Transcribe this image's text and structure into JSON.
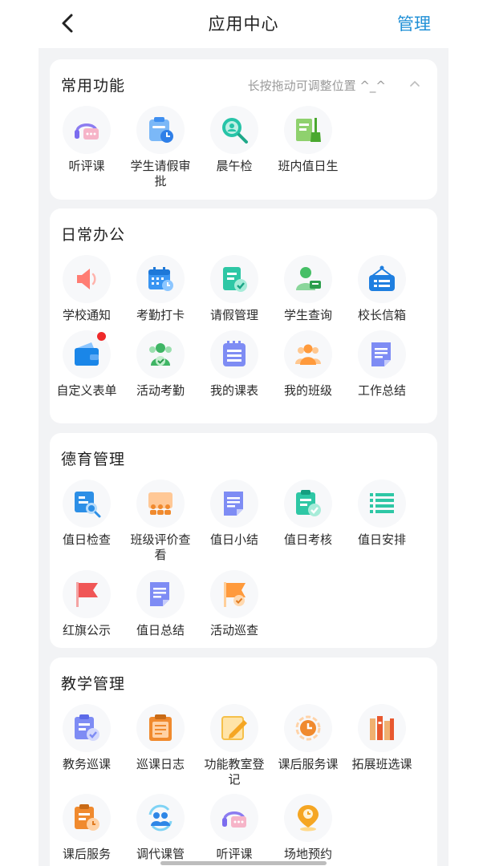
{
  "header": {
    "title": "应用中心",
    "manage_label": "管理"
  },
  "sections": [
    {
      "title": "常用功能",
      "hint": "长按拖动可调整位置 ^_^",
      "items": [
        {
          "label": "听评课",
          "icon": "headset-chat-icon"
        },
        {
          "label": "学生请假审批",
          "icon": "leave-clipboard-icon"
        },
        {
          "label": "晨午检",
          "icon": "search-person-icon"
        },
        {
          "label": "班内值日生",
          "icon": "broom-book-icon"
        }
      ]
    },
    {
      "title": "日常办公",
      "items": [
        {
          "label": "学校通知",
          "icon": "speaker-icon"
        },
        {
          "label": "考勤打卡",
          "icon": "calendar-clock-icon"
        },
        {
          "label": "请假管理",
          "icon": "document-check-icon"
        },
        {
          "label": "学生查询",
          "icon": "student-card-icon"
        },
        {
          "label": "校长信箱",
          "icon": "mailbox-sign-icon"
        },
        {
          "label": "自定义表单",
          "icon": "wallet-icon",
          "badge": true
        },
        {
          "label": "活动考勤",
          "icon": "group-check-icon"
        },
        {
          "label": "我的课表",
          "icon": "schedule-list-icon"
        },
        {
          "label": "我的班级",
          "icon": "class-group-icon"
        },
        {
          "label": "工作总结",
          "icon": "summary-doc-icon"
        }
      ]
    },
    {
      "title": "德育管理",
      "items": [
        {
          "label": "值日检查",
          "icon": "inspect-search-icon"
        },
        {
          "label": "班级评价查看",
          "icon": "class-board-icon"
        },
        {
          "label": "值日小结",
          "icon": "note-doc-icon"
        },
        {
          "label": "值日考核",
          "icon": "clipboard-check-icon"
        },
        {
          "label": "值日安排",
          "icon": "list-lines-icon"
        },
        {
          "label": "红旗公示",
          "icon": "red-flag-icon"
        },
        {
          "label": "值日总结",
          "icon": "summary-doc-icon"
        },
        {
          "label": "活动巡查",
          "icon": "flag-check-icon"
        }
      ]
    },
    {
      "title": "教学管理",
      "items": [
        {
          "label": "教务巡课",
          "icon": "clipboard-check-icon"
        },
        {
          "label": "巡课日志",
          "icon": "log-clipboard-icon"
        },
        {
          "label": "功能教室登记",
          "icon": "pencil-note-icon"
        },
        {
          "label": "课后服务课",
          "icon": "clock-cycle-icon"
        },
        {
          "label": "拓展班选课",
          "icon": "books-shelf-icon"
        },
        {
          "label": "课后服务",
          "icon": "clipboard-clock-icon"
        },
        {
          "label": "调代课管",
          "icon": "swap-users-icon"
        },
        {
          "label": "听评课",
          "icon": "headset-chat-icon"
        },
        {
          "label": "场地预约",
          "icon": "location-pin-icon"
        }
      ]
    }
  ],
  "colors": {
    "accent": "#1f8fd6",
    "badge": "#ef2a2a",
    "background": "#f2f3f5"
  }
}
